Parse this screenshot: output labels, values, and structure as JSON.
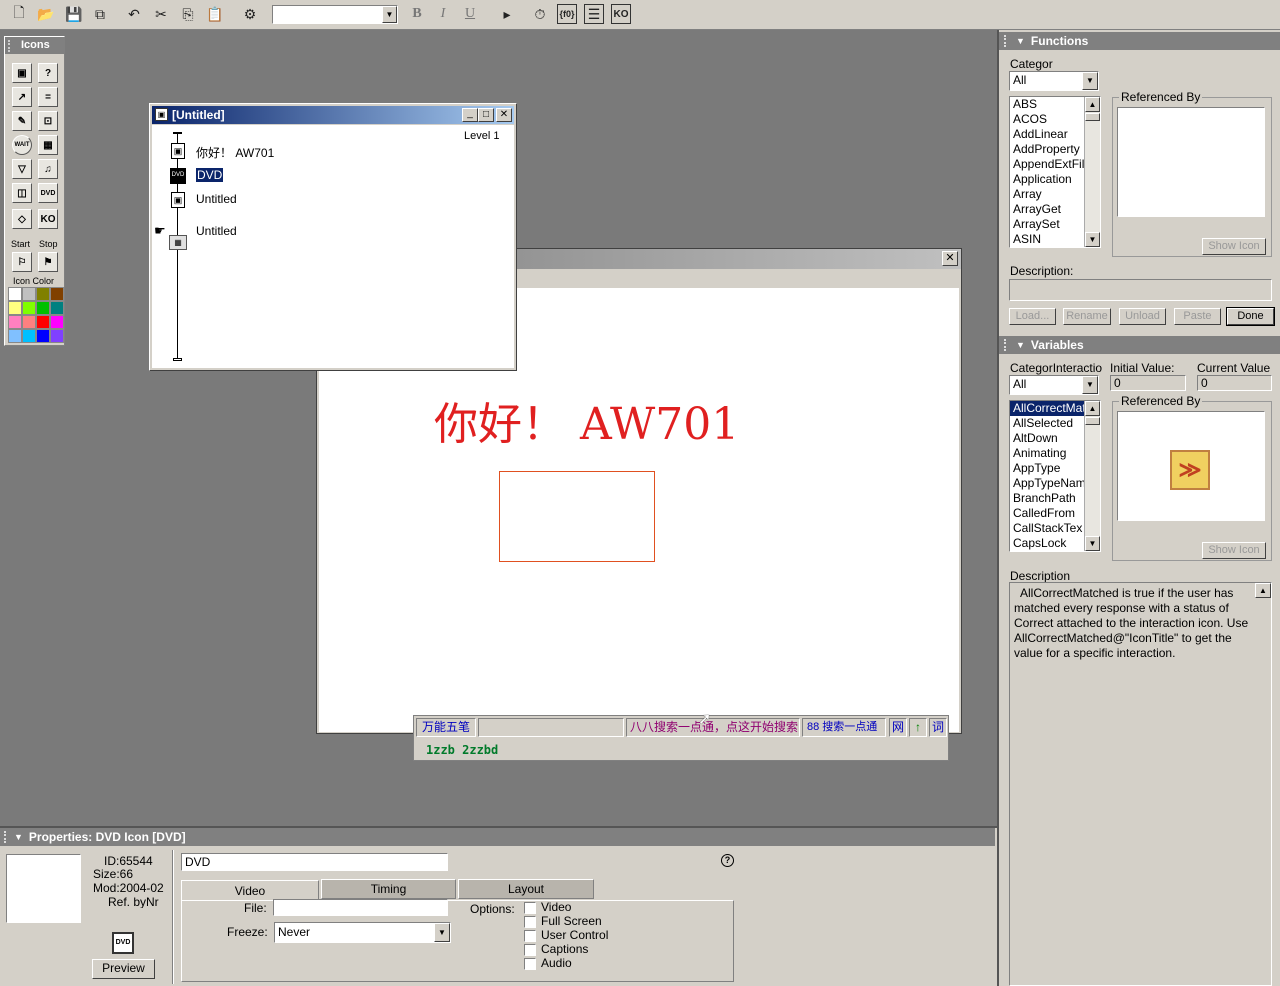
{
  "toolbar": {
    "font_select_value": "",
    "bold": "B",
    "italic": "I",
    "underline": "U"
  },
  "icons_palette": {
    "title": "Icons",
    "start_label": "Start",
    "stop_label": "Stop",
    "icon_color_label": "Icon Color",
    "colors": [
      "#ffffff",
      "#c0c0c0",
      "#808000",
      "#804000",
      "#ffff80",
      "#80ff00",
      "#00c000",
      "#008080",
      "#ff80c0",
      "#ff8080",
      "#ff0000",
      "#ff00ff",
      "#80c0ff",
      "#00c0ff",
      "#0000ff",
      "#8040ff"
    ]
  },
  "flowline_window": {
    "title": "[Untitled]",
    "level": "Level 1",
    "items": [
      {
        "label": "你好！ AW701",
        "selected": false
      },
      {
        "label": "DVD",
        "selected": true
      },
      {
        "label": "Untitled",
        "selected": false
      },
      {
        "label": "Untitled",
        "selected": false
      }
    ]
  },
  "presentation": {
    "text": "你好！ AW701"
  },
  "ime_bar": {
    "mode": "万能五笔",
    "hint": "八八搜索一点通，点这开始搜索",
    "search": "88 搜索一点通",
    "btn_net": "网",
    "btn_arrow": "↑",
    "btn_word": "词",
    "composition": "1zzb 2zzbd"
  },
  "functions_panel": {
    "title": "Functions",
    "category_label": "Categor",
    "category_value": "All",
    "items": [
      "ABS",
      "ACOS",
      "AddLinear",
      "AddProperty",
      "AppendExtFil",
      "Application",
      "Array",
      "ArrayGet",
      "ArraySet",
      "ASIN"
    ],
    "referenced_by_label": "Referenced By",
    "show_icon": "Show Icon",
    "description_label": "Description:",
    "buttons": [
      "Load...",
      "Rename",
      "Unload",
      "Paste",
      "Done"
    ]
  },
  "variables_panel": {
    "title": "Variables",
    "category_label": "CategorInteractio",
    "category_value": "All",
    "initial_value_label": "Initial Value:",
    "initial_value": "0",
    "current_value_label": "Current Value",
    "current_value": "0",
    "items": [
      "AllCorrectMat",
      "AllSelected",
      "AltDown",
      "Animating",
      "AppType",
      "AppTypeNam",
      "BranchPath",
      "CalledFrom",
      "CallStackTex",
      "CapsLock"
    ],
    "selected_index": 0,
    "referenced_by_label": "Referenced By",
    "show_icon": "Show Icon",
    "description_label": "Description",
    "description_text": "AllCorrectMatched is true if the user has matched every response with a status of Correct attached to the interaction icon. Use AllCorrectMatched@\"IconTitle\" to get the value for a specific interaction."
  },
  "properties_panel": {
    "title": "Properties: DVD Icon [DVD]",
    "id": "ID:65544",
    "size": "Size:66",
    "mod": "Mod:2004-02",
    "ref": "Ref. byNr",
    "name_value": "DVD",
    "help": "?",
    "preview": "Preview",
    "tabs": [
      "Video",
      "Timing",
      "Layout"
    ],
    "file_label": "File:",
    "file_value": "",
    "freeze_label": "Freeze:",
    "freeze_value": "Never",
    "options_label": "Options:",
    "options": [
      "Video",
      "Full Screen",
      "User Control",
      "Captions",
      "Audio"
    ]
  },
  "colors": {
    "title_bar": "#0a246a",
    "selection": "#0a246a",
    "presentation_text": "#e02020",
    "ime_green": "#007a2a"
  }
}
